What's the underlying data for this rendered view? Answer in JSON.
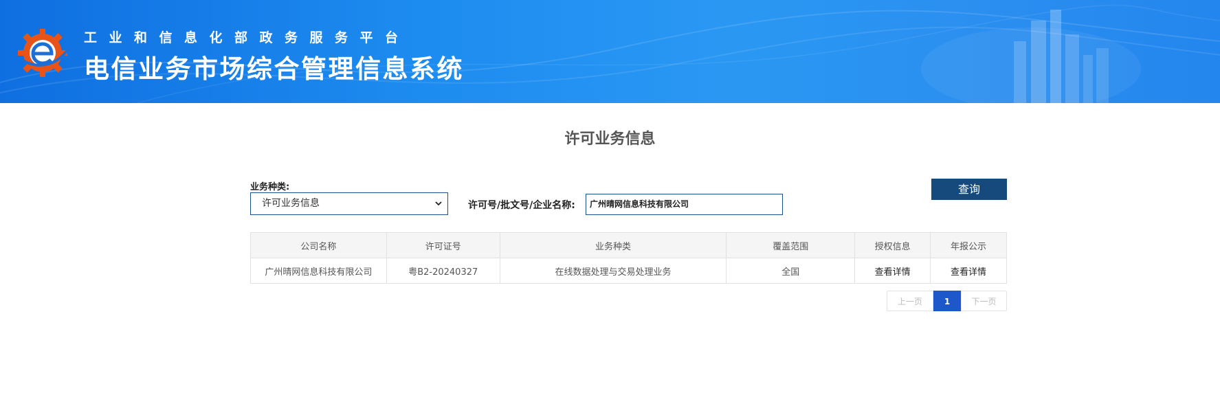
{
  "header": {
    "subtitle": "工业和信息化部政务服务平台",
    "title": "电信业务市场综合管理信息系统"
  },
  "page_title": "许可业务信息",
  "filters": {
    "type_label": "业务种类:",
    "type_selected": "许可业务信息",
    "license_label": "许可号/批文号/企业名称:",
    "license_value": "广州晴网信息科技有限公司",
    "query_button": "查询"
  },
  "table": {
    "headers": [
      "公司名称",
      "许可证号",
      "业务种类",
      "覆盖范围",
      "授权信息",
      "年报公示"
    ],
    "rows": [
      {
        "company": "广州晴网信息科技有限公司",
        "license_no": "粤B2-20240327",
        "business_type": "在线数据处理与交易处理业务",
        "coverage": "全国",
        "auth_info": "查看详情",
        "annual_report": "查看详情"
      }
    ]
  },
  "pagination": {
    "prev": "上一页",
    "current": "1",
    "next": "下一页"
  },
  "colors": {
    "header_blue": "#1d8cf0",
    "query_button": "#174a7c",
    "active_page": "#1e57c9"
  },
  "icons": {
    "logo": "gear-e-logo-icon",
    "dropdown": "chevron-down-icon"
  }
}
